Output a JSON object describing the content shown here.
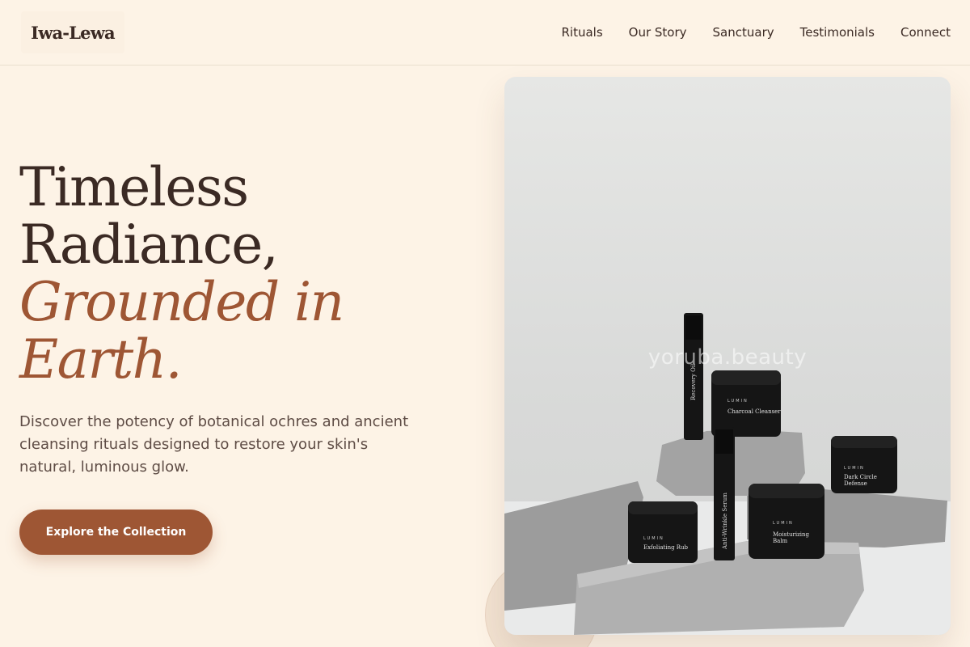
{
  "brand": {
    "name": "Iwa-Lewa"
  },
  "nav": {
    "items": [
      {
        "label": "Rituals"
      },
      {
        "label": "Our Story"
      },
      {
        "label": "Sanctuary"
      },
      {
        "label": "Testimonials"
      },
      {
        "label": "Connect"
      }
    ]
  },
  "hero": {
    "line1": "Timeless",
    "line2": "Radiance,",
    "line3": "Grounded in",
    "line4": "Earth.",
    "description": "Discover the potency of botanical ochres and ancient cleansing rituals designed to restore your skin's natural, luminous glow.",
    "cta_label": "Explore the Collection"
  },
  "image": {
    "watermark": "yoruba.beauty",
    "products": {
      "brand": "LUMIN",
      "recovery_oil": "Recovery Oil",
      "charcoal_cleanser": "Charcoal Cleanser",
      "anti_wrinkle_serum": "Anti-Wrinkle Serum",
      "exfoliating_rub": "Exfoliating Rub",
      "moisturizing_balm_1": "Moisturizing",
      "moisturizing_balm_2": "Balm",
      "dark_circle_1": "Dark Circle",
      "dark_circle_2": "Defense"
    }
  },
  "colors": {
    "background": "#fdf3e6",
    "text": "#3b2a24",
    "accent": "#9e5634",
    "muted_text": "#5e4c45"
  }
}
